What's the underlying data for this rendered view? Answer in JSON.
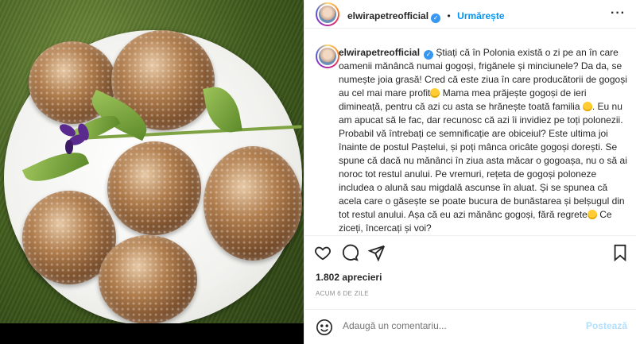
{
  "post": {
    "username": "elwirapetreofficial",
    "follow_label": "Urmărește",
    "caption_parts": [
      "Știați că în Polonia există o zi pe an în care oamenii mănâncă numai gogoși, frigănele și minciunele? Da da, se numește joia grasă! Cred că este ziua în care producătorii de gogoși au cel mai mare profit",
      "Mama mea prăjește gogoși de ieri dimineață, pentru că azi cu asta se hrănește toată familia",
      ". Eu nu am apucat să le fac, dar recunosc că azi îi invidiez pe toți polonezii. Probabil vă întrebați ce semnificație are obiceiul? Este ultima joi înainte de postul Paștelui, și poți mânca oricâte gogoși dorești. Se spune că dacă nu mănânci în ziua asta măcar o gogoașa, nu o să ai noroc tot restul anului. Pe vremuri, rețeta de gogoși poloneze includea o alună sau migdală ascunse în aluat. Și se spunea că acela care o găsește se poate bucura de bunăstarea și belșugul din tot restul anului. Așa că eu azi mănânc gogoși, fără regrete",
      " Ce ziceți, încercați și voi?"
    ],
    "likes": "1.802 aprecieri",
    "time": "ACUM 6 DE ZILE",
    "comment_placeholder": "Adaugă un comentariu...",
    "post_label": "Postează"
  },
  "icons": {
    "more": "more-options-icon",
    "like": "heart-icon",
    "comment": "comment-icon",
    "share": "send-icon",
    "save": "bookmark-icon",
    "emoji": "smiley-icon",
    "verified": "verified-badge-icon"
  },
  "colors": {
    "accent": "#0095f6",
    "verified": "#3897f0",
    "post_disabled": "#b2dffc",
    "muted": "#8e8e8e"
  }
}
